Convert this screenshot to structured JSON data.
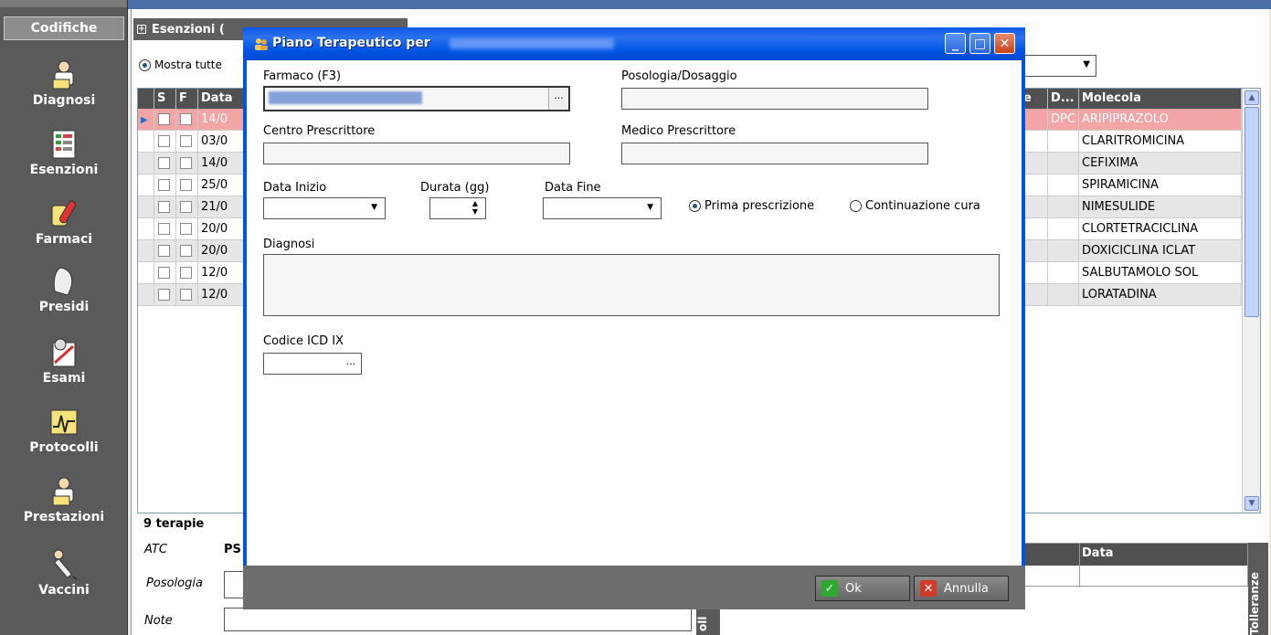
{
  "sidebar": {
    "header": "Codifiche",
    "items": [
      {
        "label": "Diagnosi",
        "icon": "doctor-diagnosis-icon"
      },
      {
        "label": "Esenzioni",
        "icon": "exemption-list-icon"
      },
      {
        "label": "Farmaci",
        "icon": "pills-icon"
      },
      {
        "label": "Presidi",
        "icon": "medical-device-icon"
      },
      {
        "label": "Esami",
        "icon": "exam-icon"
      },
      {
        "label": "Protocolli",
        "icon": "protocol-chart-icon"
      },
      {
        "label": "Prestazioni",
        "icon": "doctor-services-icon"
      },
      {
        "label": "Vaccini",
        "icon": "syringe-icon"
      }
    ]
  },
  "main": {
    "section_title": "Esenzioni (",
    "show_all_label": "Mostra tutte",
    "grid": {
      "headers": {
        "s": "S",
        "f": "F",
        "data": "Data",
        "e": "e",
        "d": "D...",
        "molecola": "Molecola"
      },
      "rows": [
        {
          "s": true,
          "f": true,
          "data": "14/0",
          "d": "DPC",
          "molecola": "ARIPIPRAZOLO"
        },
        {
          "s": false,
          "f": false,
          "data": "03/0",
          "d": "",
          "molecola": "CLARITROMICINA"
        },
        {
          "s": false,
          "f": false,
          "data": "14/0",
          "d": "",
          "molecola": "CEFIXIMA"
        },
        {
          "s": false,
          "f": false,
          "data": "25/0",
          "d": "",
          "molecola": "SPIRAMICINA"
        },
        {
          "s": false,
          "f": false,
          "data": "21/0",
          "d": "",
          "molecola": "NIMESULIDE"
        },
        {
          "s": false,
          "f": false,
          "data": "20/0",
          "d": "",
          "molecola": "CLORTETRACICLINA"
        },
        {
          "s": false,
          "f": false,
          "data": "20/0",
          "d": "",
          "molecola": "DOXICICLINA ICLAT"
        },
        {
          "s": false,
          "f": false,
          "data": "12/0",
          "d": "",
          "molecola": "SALBUTAMOLO SOL"
        },
        {
          "s": false,
          "f": false,
          "data": "12/0",
          "d": "",
          "molecola": "LORATADINA"
        }
      ]
    },
    "count_label": "9 terapie",
    "atc_label": "ATC",
    "atc_value": "PS",
    "posologia_label": "Posologia",
    "note_label": "Note",
    "side_tab": "oll",
    "right_table_header": "Data",
    "right_tab": "Tolleranze"
  },
  "dialog": {
    "title": "Piano Terapeutico per",
    "labels": {
      "farmaco": "Farmaco (F3)",
      "posologia": "Posologia/Dosaggio",
      "centro": "Centro Prescrittore",
      "medico": "Medico Prescrittore",
      "data_inizio": "Data Inizio",
      "durata": "Durata (gg)",
      "data_fine": "Data Fine",
      "prima": "Prima prescrizione",
      "continuazione": "Continuazione cura",
      "diagnosi": "Diagnosi",
      "icd": "Codice ICD IX"
    },
    "ellipsis": "...",
    "buttons": {
      "ok": "Ok",
      "annulla": "Annulla"
    }
  },
  "colors": {
    "titlebar": "#0054e3",
    "selected_row": "#f3a4a4",
    "sidebar_bg": "#5a5a5a",
    "ok_green": "#2fa82f",
    "cancel_red": "#d43a2a"
  }
}
